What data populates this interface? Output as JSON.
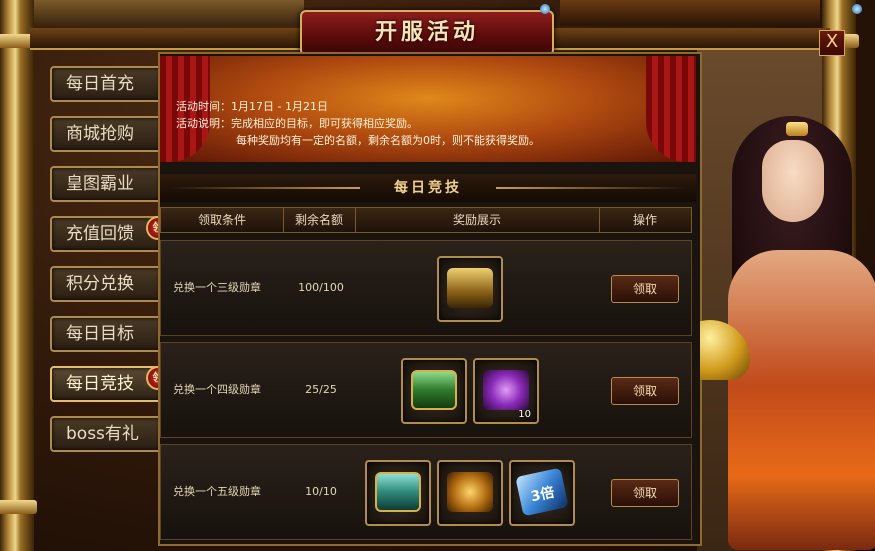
{
  "window": {
    "title": "开服活动",
    "close_label": "X"
  },
  "tabs": [
    {
      "label": "每日首充",
      "badge": null,
      "active": false
    },
    {
      "label": "商城抢购",
      "badge": null,
      "active": false
    },
    {
      "label": "皇图霸业",
      "badge": null,
      "active": false
    },
    {
      "label": "充值回馈",
      "badge": "领",
      "active": false
    },
    {
      "label": "积分兑换",
      "badge": null,
      "active": false
    },
    {
      "label": "每日目标",
      "badge": null,
      "active": false
    },
    {
      "label": "每日竞技",
      "badge": "领",
      "active": true
    },
    {
      "label": "boss有礼",
      "badge": null,
      "active": false
    }
  ],
  "activity": {
    "time_label": "活动时间：1月17日 - 1月21日",
    "desc_label": "活动说明：完成相应的目标，即可获得相应奖励。",
    "desc_line2": "每种奖励均有一定的名额，剩余名额为0时，则不能获得奖励。"
  },
  "section": {
    "title": "每日竞技"
  },
  "table": {
    "headers": [
      "领取条件",
      "剩余名额",
      "奖励展示",
      "操作"
    ],
    "rows": [
      {
        "condition": "兑换一个三级勋章",
        "remaining": "100/100",
        "items": [
          {
            "icon": "gold-chest-icon",
            "qty": ""
          }
        ],
        "action": "领取"
      },
      {
        "condition": "兑换一个四级勋章",
        "remaining": "25/25",
        "items": [
          {
            "icon": "green-chest-icon",
            "qty": ""
          },
          {
            "icon": "purple-chain-icon",
            "qty": "10"
          }
        ],
        "action": "领取"
      },
      {
        "condition": "兑换一个五级勋章",
        "remaining": "10/10",
        "items": [
          {
            "icon": "teal-chest-icon",
            "qty": ""
          },
          {
            "icon": "gold-chain-icon",
            "qty": ""
          },
          {
            "icon": "blue-card-icon",
            "qty": "",
            "card_text": "3倍"
          }
        ],
        "action": "领取"
      }
    ]
  },
  "colors": {
    "accent_gold": "#d9ae5a",
    "title_red": "#8e1d1d",
    "text_light": "#e6d6b6"
  }
}
